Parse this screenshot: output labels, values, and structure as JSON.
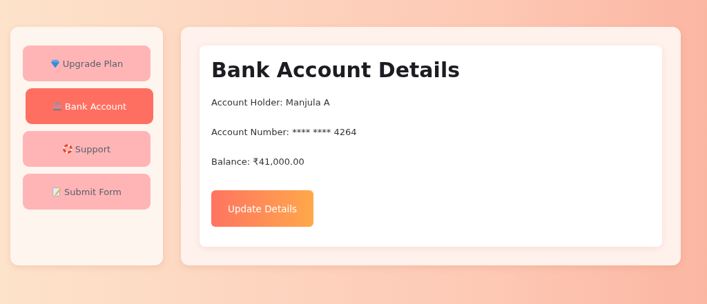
{
  "sidebar": {
    "items": [
      {
        "label": "Upgrade Plan",
        "selected": false
      },
      {
        "label": "Bank Account",
        "selected": true
      },
      {
        "label": "Support",
        "selected": false
      },
      {
        "label": "Submit Form",
        "selected": false
      }
    ]
  },
  "card": {
    "title": "Bank Account Details",
    "lines": [
      "Account Holder: Manjula A",
      "Account Number: **** **** 4264",
      "Balance: ₹41,000.00"
    ],
    "button": "Update Details"
  }
}
